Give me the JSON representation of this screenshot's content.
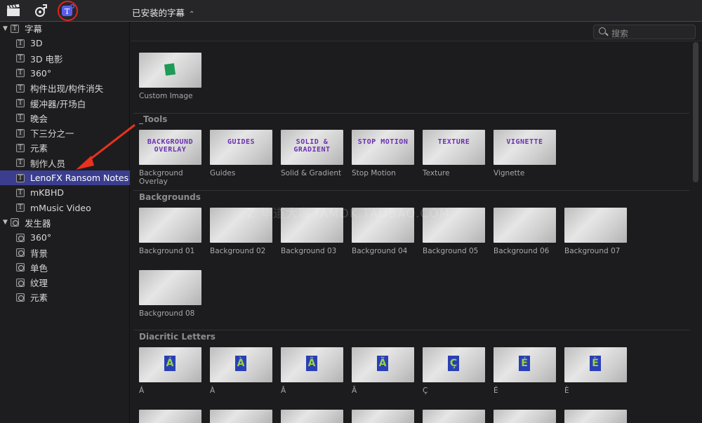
{
  "toolbar": {
    "title": "已安装的字幕",
    "chevron": "⌃⌄",
    "icons": [
      "clapper-icon",
      "music-icon",
      "titles-icon"
    ]
  },
  "sidebar": {
    "titles_group": "字幕",
    "titles_items": [
      "3D",
      "3D 电影",
      "360°",
      "构件出现/构件消失",
      "缓冲器/开场白",
      "晚会",
      "下三分之一",
      "元素",
      "制作人员",
      "LenoFX Ransom Notes",
      "mKBHD",
      "mMusic Video"
    ],
    "selected": "LenoFX Ransom Notes",
    "generators_group": "发生器",
    "generators_items": [
      "360°",
      "背景",
      "单色",
      "纹理",
      "元素"
    ]
  },
  "search": {
    "placeholder": "搜索"
  },
  "watermark": "Z 毕道大咖  IAMDK.TAOBAO.COM",
  "sections": {
    "top": [
      {
        "label": "Custom Image"
      }
    ],
    "tools_title": "_Tools",
    "tools": [
      {
        "label": "Background Overlay",
        "art": "BACKGROUND OVERLAY"
      },
      {
        "label": "Guides",
        "art": "GUIDES"
      },
      {
        "label": "Solid & Gradient",
        "art": "SOLID & GRADIENT"
      },
      {
        "label": "Stop Motion",
        "art": "STOP MOTION"
      },
      {
        "label": "Texture",
        "art": "TEXTURE"
      },
      {
        "label": "Vignette",
        "art": "VIGNETTE"
      }
    ],
    "backgrounds_title": "Backgrounds",
    "backgrounds": [
      "Background 01",
      "Background 02",
      "Background 03",
      "Background 04",
      "Background 05",
      "Background 06",
      "Background 07",
      "Background 08"
    ],
    "diacritic_title": "Diacritic Letters",
    "diacritic": [
      {
        "label": "Á",
        "glyph": "Á"
      },
      {
        "label": "À",
        "glyph": "À"
      },
      {
        "label": "Â",
        "glyph": "Â"
      },
      {
        "label": "Ã",
        "glyph": "Ã"
      },
      {
        "label": "Ç",
        "glyph": "Ç"
      },
      {
        "label": "É",
        "glyph": "É"
      },
      {
        "label": "È",
        "glyph": "È"
      }
    ]
  },
  "colors": {
    "selection": "#3b3e8f",
    "accent_ring": "#e0231f",
    "arrow": "#e8321f"
  }
}
